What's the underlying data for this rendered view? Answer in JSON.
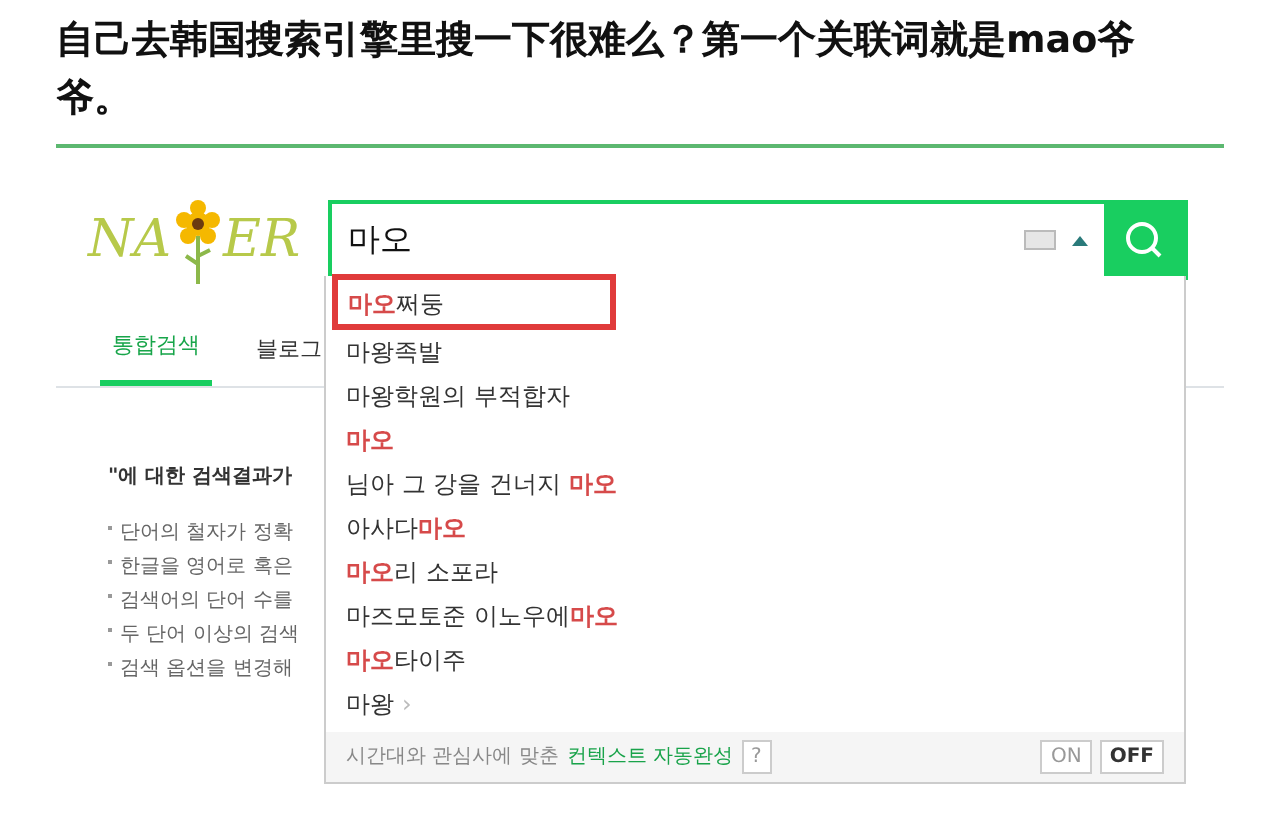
{
  "headline": "自己去韩国搜索引擎里搜一下很难么？第一个关联词就是mao爷爷。",
  "logo": {
    "left": "NA",
    "right": "ER"
  },
  "search": {
    "value": "마오"
  },
  "tabs": [
    {
      "label": "통합검색",
      "selected": true
    },
    {
      "label": "블로그",
      "selected": false
    }
  ],
  "results": {
    "notice": "\"에 대한 검색결과가",
    "tips": [
      "단어의 철자가 정확",
      "한글을 영어로 혹은",
      "검색어의 단어 수를",
      "두 단어 이상의 검색",
      "검색 옵션을 변경해"
    ]
  },
  "suggestions": [
    {
      "marked": true,
      "parts": [
        {
          "text": "마오",
          "highlight": true
        },
        {
          "text": "쩌둥",
          "highlight": false
        }
      ]
    },
    {
      "marked": false,
      "parts": [
        {
          "text": "마왕족발",
          "highlight": false
        }
      ]
    },
    {
      "marked": false,
      "parts": [
        {
          "text": "마왕학원의 부적합자",
          "highlight": false
        }
      ]
    },
    {
      "marked": false,
      "parts": [
        {
          "text": "마오",
          "highlight": true
        }
      ]
    },
    {
      "marked": false,
      "parts": [
        {
          "text": "님아 그 강을 건너지 ",
          "highlight": false
        },
        {
          "text": "마오",
          "highlight": true
        }
      ]
    },
    {
      "marked": false,
      "parts": [
        {
          "text": "아사다",
          "highlight": false
        },
        {
          "text": "마오",
          "highlight": true
        }
      ]
    },
    {
      "marked": false,
      "parts": [
        {
          "text": "마오",
          "highlight": true
        },
        {
          "text": "리 소포라",
          "highlight": false
        }
      ]
    },
    {
      "marked": false,
      "parts": [
        {
          "text": "마즈모토준 이노우에",
          "highlight": false
        },
        {
          "text": "마오",
          "highlight": true
        }
      ]
    },
    {
      "marked": false,
      "parts": [
        {
          "text": "마오",
          "highlight": true
        },
        {
          "text": "타이주",
          "highlight": false
        }
      ]
    },
    {
      "marked": false,
      "more": "›",
      "parts": [
        {
          "text": "마왕",
          "highlight": false
        }
      ]
    }
  ],
  "footer": {
    "text": "시간대와 관심사에 맞춘",
    "link": "컨텍스트 자동완성",
    "help": "?",
    "toggles": [
      {
        "label": "ON",
        "selected": false
      },
      {
        "label": "OFF",
        "selected": true
      }
    ]
  }
}
